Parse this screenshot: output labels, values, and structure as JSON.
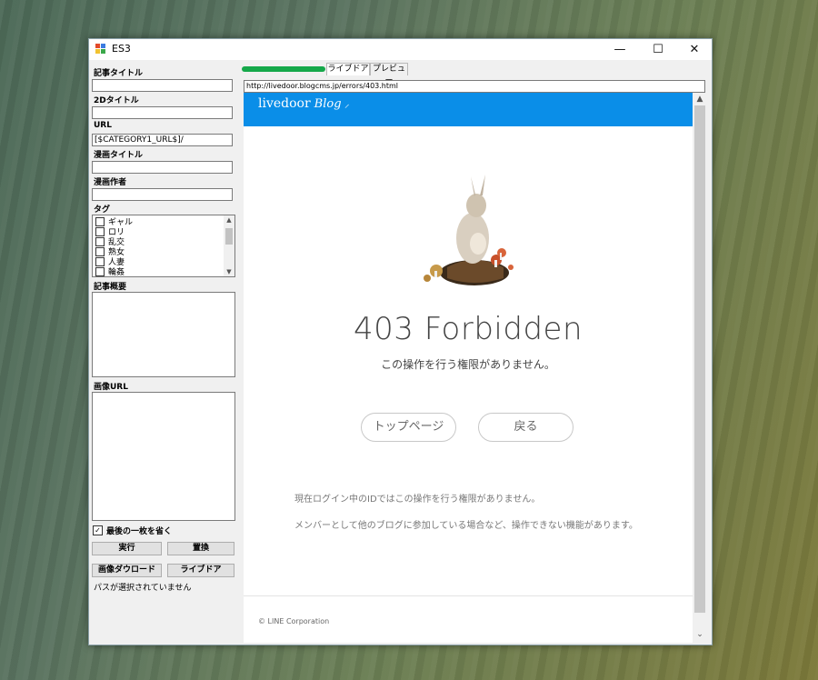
{
  "window": {
    "title": "ES3",
    "min": "—",
    "max": "☐",
    "close": "✕"
  },
  "form": {
    "article_title_label": "記事タイトル",
    "article_title_value": "",
    "title2d_label": "2Dタイトル",
    "title2d_value": "",
    "url_label": "URL",
    "url_value": "[$CATEGORY1_URL$]/",
    "manga_title_label": "漫画タイトル",
    "manga_title_value": "",
    "manga_author_label": "漫画作者",
    "manga_author_value": "",
    "tag_label": "タグ",
    "tags": [
      {
        "label": "ギャル",
        "checked": false
      },
      {
        "label": "ロリ",
        "checked": false
      },
      {
        "label": "乱交",
        "checked": false
      },
      {
        "label": "熟女",
        "checked": false
      },
      {
        "label": "人妻",
        "checked": false
      },
      {
        "label": "輪姦",
        "checked": false
      }
    ],
    "summary_label": "記事概要",
    "summary_value": "",
    "image_url_label": "画像URL",
    "image_url_value": "",
    "skip_last_label": "最後の一枚を省く",
    "skip_last_checked": true,
    "run_button": "実行",
    "replace_button": "置換",
    "download_button": "画像ダウロード",
    "livedoor_button": "ライブドア",
    "status": "パスが選択されていません"
  },
  "tabs": [
    {
      "label": "ライブドア",
      "active": true
    },
    {
      "label": "プレビュー",
      "active": false
    }
  ],
  "browser": {
    "url": "http://livedoor.blogcms.jp/errors/403.html"
  },
  "page": {
    "logo_main": "livedoor",
    "logo_blog": "Blog",
    "heading": "403 Forbidden",
    "subheading": "この操作を行う権限がありません。",
    "top_button": "トップページ",
    "back_button": "戻る",
    "message1": "現在ログイン中のIDではこの操作を行う権限がありません。",
    "message2": "メンバーとして他のブログに参加している場合など、操作できない機能があります。",
    "copyright": "© LINE Corporation"
  },
  "colors": {
    "banner": "#0a8ee8",
    "window_bg": "#f0f0f0"
  }
}
